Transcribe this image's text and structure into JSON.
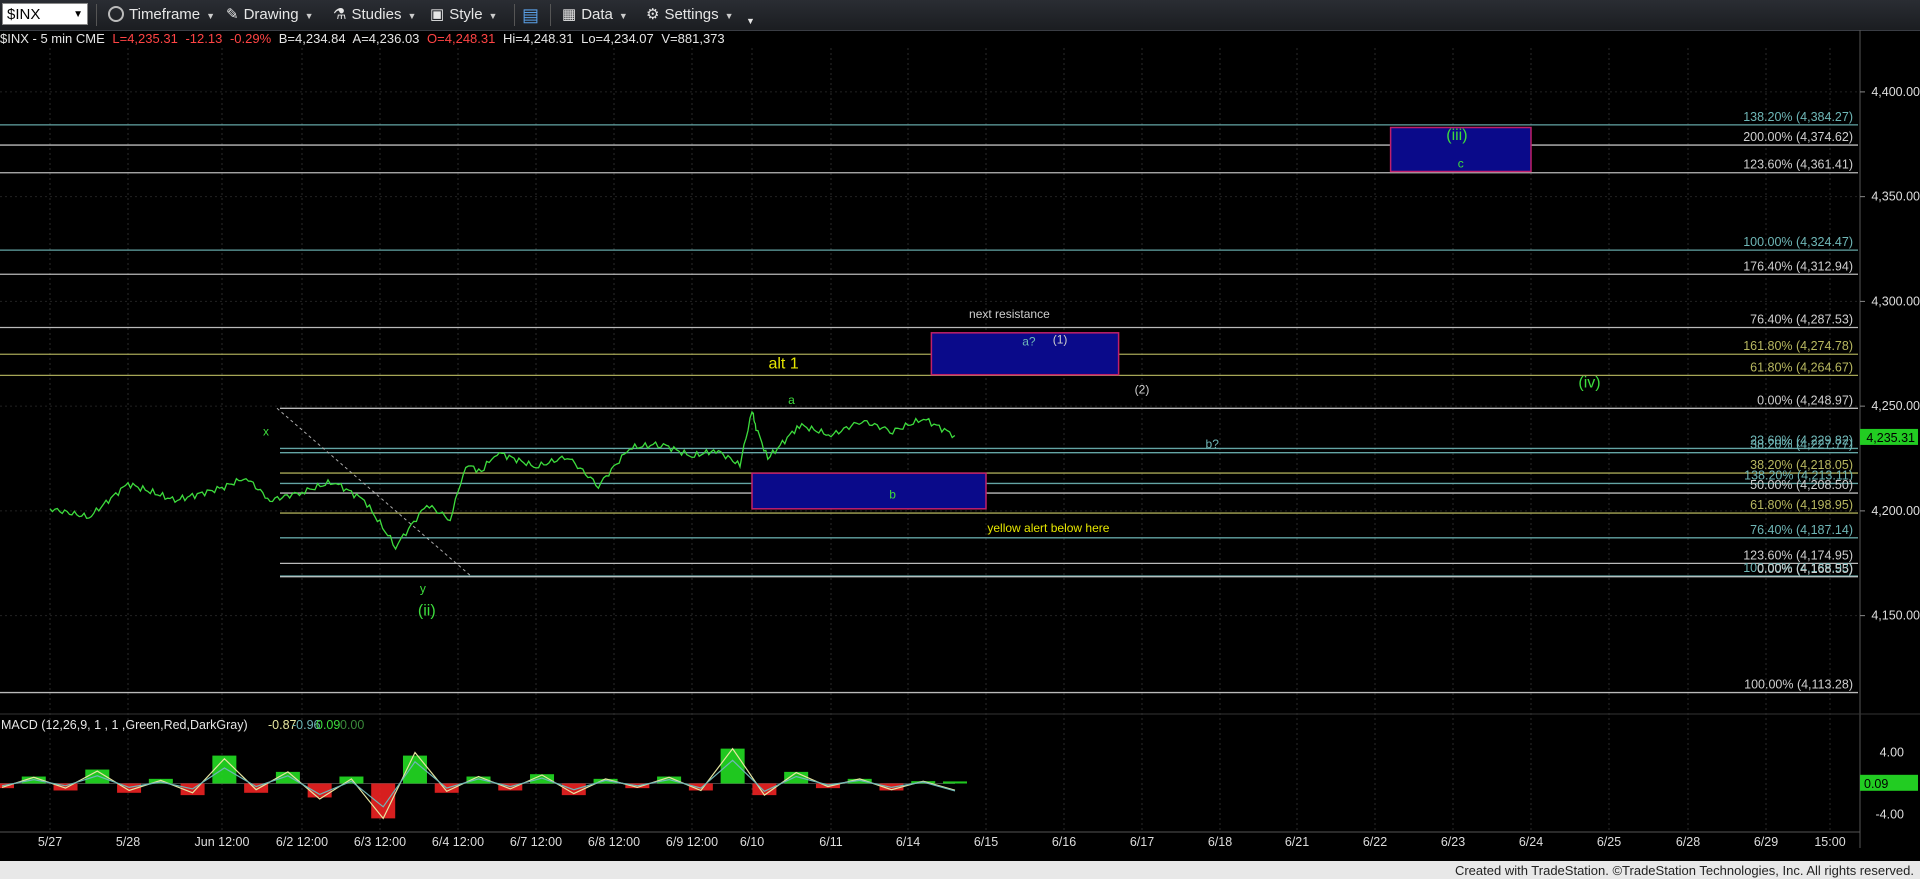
{
  "toolbar": {
    "symbol": "$INX",
    "timeframe_label": "Timeframe",
    "drawing_label": "Drawing",
    "studies_label": "Studies",
    "style_label": "Style",
    "data_label": "Data",
    "settings_label": "Settings"
  },
  "info_bar": {
    "symbol_desc": "$INX - 5 min  CME",
    "last": "L=4,235.31",
    "change": "-12.13",
    "change_pct": "-0.29%",
    "bid": "B=4,234.84",
    "ask": "A=4,236.03",
    "open": "O=4,248.31",
    "high": "Hi=4,248.31",
    "low": "Lo=4,234.07",
    "volume": "V=881,373"
  },
  "colors": {
    "background": "#000000",
    "price_line": "#3ddc3d",
    "level_line": "#cfcfcf",
    "teal_text": "#6fb7b7",
    "olive_text": "#b8b860",
    "yellow": "#e6e600",
    "box_fill": "#0a0a8a",
    "box_border": "#c0206a",
    "macd_pos": "#22dd22",
    "macd_neg": "#ee2222",
    "last_price_badge": "#22cc22"
  },
  "footer": "Created with TradeStation. ©TradeStation Technologies, Inc. All rights reserved.",
  "chart_data": {
    "type": "line",
    "title": "",
    "ylim": [
      4104,
      4420
    ],
    "y_ticks": [
      {
        "value": 4400,
        "label": "4,400.00"
      },
      {
        "value": 4350,
        "label": "4,350.00"
      },
      {
        "value": 4300,
        "label": "4,300.00"
      },
      {
        "value": 4250,
        "label": "4,250.00"
      },
      {
        "value": 4200,
        "label": "4,200.00"
      },
      {
        "value": 4150,
        "label": "4,150.00"
      }
    ],
    "x_ticks": [
      "5/27",
      "5/28",
      "Jun 12:00",
      "6/2 12:00",
      "6/3 12:00",
      "6/4 12:00",
      "6/7 12:00",
      "6/8 12:00",
      "6/9 12:00",
      "6/10",
      "6/11",
      "6/14",
      "6/15",
      "6/16",
      "6/17",
      "6/18",
      "6/21",
      "6/22",
      "6/23",
      "6/24",
      "6/25",
      "6/28",
      "6/29",
      "15:00"
    ],
    "last_price": {
      "value": 4235.31,
      "label": "4,235.31"
    },
    "series": [
      {
        "x": [
          0,
          0.5,
          1,
          1.5,
          2,
          2.3,
          2.6,
          3,
          3.4,
          3.8,
          4.2,
          4.6,
          4.9,
          5.1,
          5.3,
          5.5,
          6,
          6.4,
          6.8,
          7.2,
          7.6,
          8,
          8.4,
          8.8,
          9.0,
          9.05,
          9.2,
          9.6,
          10,
          10.4,
          10.8,
          11.2,
          11.6
        ],
        "y": [
          4201,
          4197,
          4213,
          4205,
          4211,
          4216,
          4205,
          4209,
          4214,
          4205,
          4183,
          4203,
          4196,
          4222,
          4219,
          4228,
          4221,
          4226,
          4212,
          4230,
          4232,
          4226,
          4229,
          4222,
          4248,
          4240,
          4225,
          4241,
          4236,
          4243,
          4238,
          4244,
          4236
        ]
      }
    ],
    "fib_levels": [
      {
        "value": 4384.27,
        "label": "138.20% (4,384.27)",
        "color": "#6fb7b7"
      },
      {
        "value": 4374.62,
        "label": "200.00% (4,374.62)",
        "color": "#cfcfcf"
      },
      {
        "value": 4361.41,
        "label": "123.60% (4,361.41)",
        "color": "#cfcfcf"
      },
      {
        "value": 4324.47,
        "label": "100.00% (4,324.47)",
        "color": "#6fb7b7"
      },
      {
        "value": 4312.94,
        "label": "176.40% (4,312.94)",
        "color": "#cfcfcf"
      },
      {
        "value": 4287.53,
        "label": "76.40% (4,287.53)",
        "color": "#cfcfcf"
      },
      {
        "value": 4274.78,
        "label": "161.80% (4,274.78)",
        "color": "#b8b860"
      },
      {
        "value": 4264.67,
        "label": "61.80% (4,264.67)",
        "color": "#b8b860"
      },
      {
        "value": 4248.97,
        "label": "0.00% (4,248.97)",
        "color": "#cfcfcf"
      },
      {
        "value": 4229.82,
        "label": "23.60% (4,229.82)",
        "color": "#6fb7b7"
      },
      {
        "value": 4227.77,
        "label": "38.20% (4,227.77)",
        "color": "#6fb7b7"
      },
      {
        "value": 4218.05,
        "label": "38.20% (4,218.05)",
        "color": "#b8b860"
      },
      {
        "value": 4213.11,
        "label": "138.20% (4,213.11)",
        "color": "#6fb7b7"
      },
      {
        "value": 4208.5,
        "label": "50.00% (4,208.50)",
        "color": "#cfcfcf"
      },
      {
        "value": 4198.95,
        "label": "61.80% (4,198.95)",
        "color": "#b8b860"
      },
      {
        "value": 4187.14,
        "label": "76.40% (4,187.14)",
        "color": "#6fb7b7"
      },
      {
        "value": 4174.95,
        "label": "123.60% (4,174.95)",
        "color": "#cfcfcf"
      },
      {
        "value": 4168.93,
        "label": "100.00% (4,168.93)",
        "color": "#6fb7b7"
      },
      {
        "value": 4168.55,
        "label": "0.00% (4,168.55)",
        "color": "#cfcfcf"
      },
      {
        "value": 4113.28,
        "label": "100.00% (4,113.28)",
        "color": "#cfcfcf"
      }
    ],
    "boxes": [
      {
        "x0": 17.2,
        "x1": 19.0,
        "y0": 4362,
        "y1": 4383
      },
      {
        "x0": 11.3,
        "x1": 13.7,
        "y0": 4265,
        "y1": 4285
      },
      {
        "x0": 9.0,
        "x1": 12.0,
        "y0": 4201,
        "y1": 4218
      }
    ],
    "annotations": [
      {
        "text": "(iii)",
        "x": 18.05,
        "y": 4377,
        "color": "#3ddc3d"
      },
      {
        "text": "c",
        "x": 18.1,
        "y": 4364,
        "color": "#3ddc3d"
      },
      {
        "text": "next resistance",
        "x": 12.3,
        "y": 4292,
        "color": "#cfcfcf"
      },
      {
        "text": "a?",
        "x": 12.55,
        "y": 4279,
        "color": "#6fb7b7"
      },
      {
        "text": "(1)",
        "x": 12.95,
        "y": 4280,
        "color": "#cfcfcf"
      },
      {
        "text": "(2)",
        "x": 14.0,
        "y": 4256,
        "color": "#cfcfcf"
      },
      {
        "text": "alt 1",
        "x": 9.4,
        "y": 4268,
        "color": "#e6e600"
      },
      {
        "text": "a",
        "x": 9.5,
        "y": 4251,
        "color": "#3ddc3d"
      },
      {
        "text": "(iv)",
        "x": 19.75,
        "y": 4259,
        "color": "#3ddc3d"
      },
      {
        "text": "b?",
        "x": 14.9,
        "y": 4230,
        "color": "#6fb7b7"
      },
      {
        "text": "x",
        "x": 2.55,
        "y": 4236,
        "color": "#3ddc3d"
      },
      {
        "text": "b",
        "x": 10.8,
        "y": 4206,
        "color": "#3ddc3d"
      },
      {
        "text": "yellow alert below here",
        "x": 12.8,
        "y": 4190,
        "color": "#e6e600"
      },
      {
        "text": "y",
        "x": 4.55,
        "y": 4161,
        "color": "#3ddc3d"
      },
      {
        "text": "(ii)",
        "x": 4.6,
        "y": 4150,
        "color": "#3ddc3d"
      }
    ]
  },
  "macd": {
    "label": "MACD (12,26,9, 1 , 1 ,Green,Red,DarkGray)",
    "values": [
      "-0.87",
      "-0.96",
      "0.09",
      "0.00"
    ],
    "value_colors": [
      "#e6e6a0",
      "#6fb7b7",
      "#3ddc3d",
      "#3a8a3a"
    ],
    "y_ticks": [
      {
        "value": 4,
        "label": "4.00"
      },
      {
        "value": -4,
        "label": "-4.00"
      }
    ],
    "ylim": [
      -6,
      6
    ],
    "last_value": {
      "value": 0.09,
      "label": "0.09"
    },
    "macd_line": [
      -0.5,
      0.8,
      -0.6,
      1.6,
      -0.9,
      0.4,
      -1.2,
      3.2,
      -0.8,
      1.5,
      -2.0,
      0.6,
      -4.5,
      4.0,
      -1.0,
      0.9,
      -0.7,
      1.1,
      -1.3,
      0.6,
      -0.5,
      0.8,
      -0.9,
      4.5,
      -1.5,
      1.4,
      -0.4,
      0.6,
      -0.8,
      0.3,
      -0.87
    ],
    "signal_line": [
      -0.3,
      0.5,
      -0.3,
      1.0,
      -0.5,
      0.2,
      -0.7,
      2.0,
      -0.4,
      1.0,
      -1.4,
      0.3,
      -3.0,
      2.8,
      -0.6,
      0.6,
      -0.4,
      0.7,
      -0.8,
      0.4,
      -0.3,
      0.5,
      -0.6,
      3.0,
      -1.0,
      0.9,
      -0.2,
      0.4,
      -0.5,
      0.2,
      -0.96
    ],
    "histogram": [
      -0.2,
      0.3,
      -0.3,
      0.6,
      -0.4,
      0.2,
      -0.5,
      1.2,
      -0.4,
      0.5,
      -0.6,
      0.3,
      -1.5,
      1.2,
      -0.4,
      0.3,
      -0.3,
      0.4,
      -0.5,
      0.2,
      -0.2,
      0.3,
      -0.3,
      1.5,
      -0.5,
      0.5,
      -0.2,
      0.2,
      -0.3,
      0.1,
      0.09
    ]
  }
}
